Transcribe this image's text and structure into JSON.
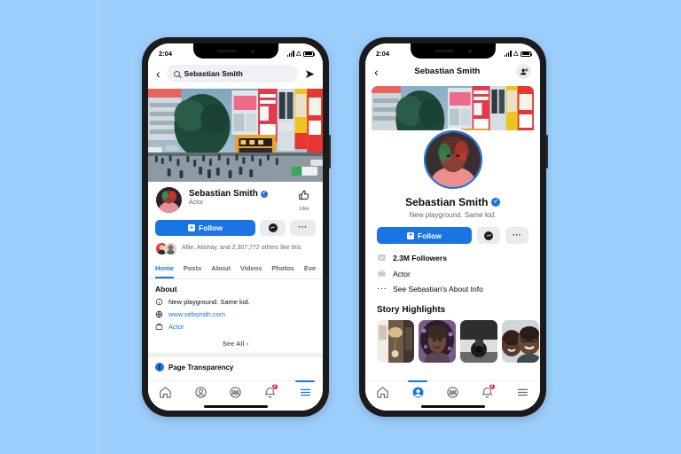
{
  "background": {
    "color": "#9ccefc"
  },
  "theme": {
    "accent": "#1b74e4",
    "badge": "#e41e3f",
    "muted": "#65676b"
  },
  "phone_left": {
    "status": {
      "time": "2:04"
    },
    "search": {
      "back_icon": "chevron-left-icon",
      "query": "Sebastian Smith",
      "placeholder": "Search",
      "share_icon": "share-arrow-icon"
    },
    "profile": {
      "name": "Sebastian Smith",
      "subtitle": "Actor",
      "like_label": "Like"
    },
    "actions": {
      "follow": "Follow",
      "message_icon": "messenger-icon",
      "more_icon": "more-horizontal-icon"
    },
    "likers": {
      "text": "Allie, Atishay, and 2,307,772 others like this"
    },
    "tabs": [
      {
        "label": "Home",
        "active": true
      },
      {
        "label": "Posts",
        "active": false
      },
      {
        "label": "About",
        "active": false
      },
      {
        "label": "Videos",
        "active": false
      },
      {
        "label": "Photos",
        "active": false
      },
      {
        "label": "Eve",
        "active": false
      }
    ],
    "about": {
      "title": "About",
      "rows": [
        {
          "icon": "info-icon",
          "text": "New playground. Same kid.",
          "link": false
        },
        {
          "icon": "globe-icon",
          "text": "www.sebsmith.com",
          "link": true
        },
        {
          "icon": "briefcase-icon",
          "text": "Actor",
          "link": true
        }
      ],
      "see_all": "See All  ›"
    },
    "page_transparency": {
      "label": "Page Transparency",
      "badge": "f"
    },
    "bottom_nav": [
      {
        "icon": "home-icon",
        "active": false,
        "badge": null
      },
      {
        "icon": "profile-icon",
        "active": false,
        "badge": null
      },
      {
        "icon": "groups-icon",
        "active": false,
        "badge": null
      },
      {
        "icon": "notifications-icon",
        "active": false,
        "badge": "2"
      },
      {
        "icon": "menu-icon",
        "active": true,
        "badge": null
      }
    ]
  },
  "phone_right": {
    "status": {
      "time": "2:04"
    },
    "header": {
      "back_icon": "chevron-left-icon",
      "title": "Sebastian Smith",
      "add_friend_icon": "add-friend-icon"
    },
    "profile": {
      "name": "Sebastian Smith",
      "subtitle": "New playground. Same kid."
    },
    "actions": {
      "follow": "Follow",
      "message_icon": "messenger-icon",
      "more_icon": "more-horizontal-icon"
    },
    "info_rows": [
      {
        "icon": "followers-icon",
        "text": "2.3M Followers",
        "bold": true
      },
      {
        "icon": "briefcase-icon",
        "text": "Actor",
        "bold": false
      },
      {
        "icon": "more-horizontal-icon",
        "text": "See Sebastian's About Info",
        "bold": false
      }
    ],
    "highlights": {
      "title": "Story Highlights",
      "items": [
        {
          "name": "interior-lamp"
        },
        {
          "name": "woman-braids"
        },
        {
          "name": "bw-object"
        },
        {
          "name": "two-people-smiling"
        }
      ]
    },
    "bottom_nav": [
      {
        "icon": "home-icon",
        "active": false,
        "badge": null
      },
      {
        "icon": "profile-icon",
        "active": true,
        "badge": null
      },
      {
        "icon": "groups-icon",
        "active": false,
        "badge": null
      },
      {
        "icon": "notifications-icon",
        "active": false,
        "badge": "2"
      },
      {
        "icon": "menu-icon",
        "active": false,
        "badge": null
      }
    ]
  }
}
